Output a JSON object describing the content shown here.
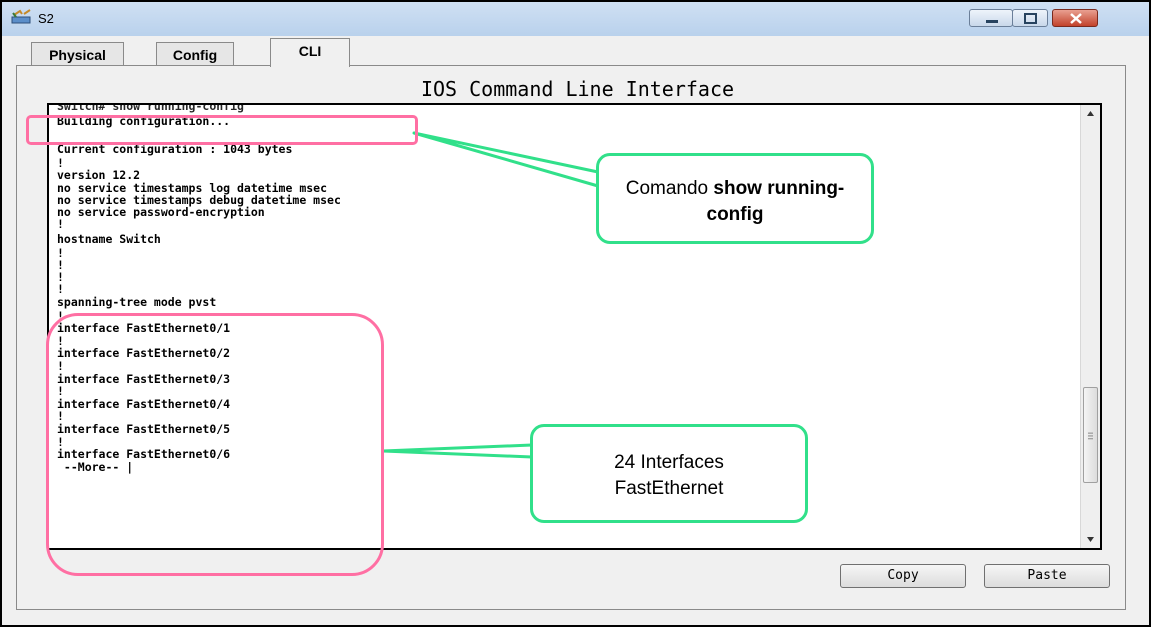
{
  "window": {
    "title": "S2",
    "icon": "switch-icon",
    "controls": [
      "minimize-icon",
      "maximize-icon",
      "close-icon"
    ]
  },
  "tabs": [
    {
      "label": "Physical",
      "active": false
    },
    {
      "label": "Config",
      "active": false
    },
    {
      "label": "CLI",
      "active": true
    }
  ],
  "cli": {
    "heading": "IOS Command Line Interface",
    "lines": [
      "Switch# show running-config",
      "Building configuration...",
      "",
      "Current configuration : 1043 bytes",
      "!",
      "version 12.2",
      "no service timestamps log datetime msec",
      "no service timestamps debug datetime msec",
      "no service password-encryption",
      "!",
      "hostname Switch",
      "!",
      "!",
      "!",
      "!",
      "spanning-tree mode pvst",
      "!",
      "interface FastEthernet0/1",
      "!",
      "interface FastEthernet0/2",
      "!",
      "interface FastEthernet0/3",
      "!",
      "interface FastEthernet0/4",
      "!",
      "interface FastEthernet0/5",
      "!",
      "interface FastEthernet0/6",
      " --More-- |"
    ],
    "scroll_position": 0.85
  },
  "buttons": {
    "copy": "Copy",
    "paste": "Paste"
  },
  "annotations": {
    "callout_top": {
      "prefix": "Comando ",
      "bold": "show running-config"
    },
    "callout_bottom": {
      "line1": "24 Interfaces",
      "line2": "FastEthernet"
    },
    "highlight_color": "#ff6fa3",
    "callout_color": "#31e08a"
  }
}
